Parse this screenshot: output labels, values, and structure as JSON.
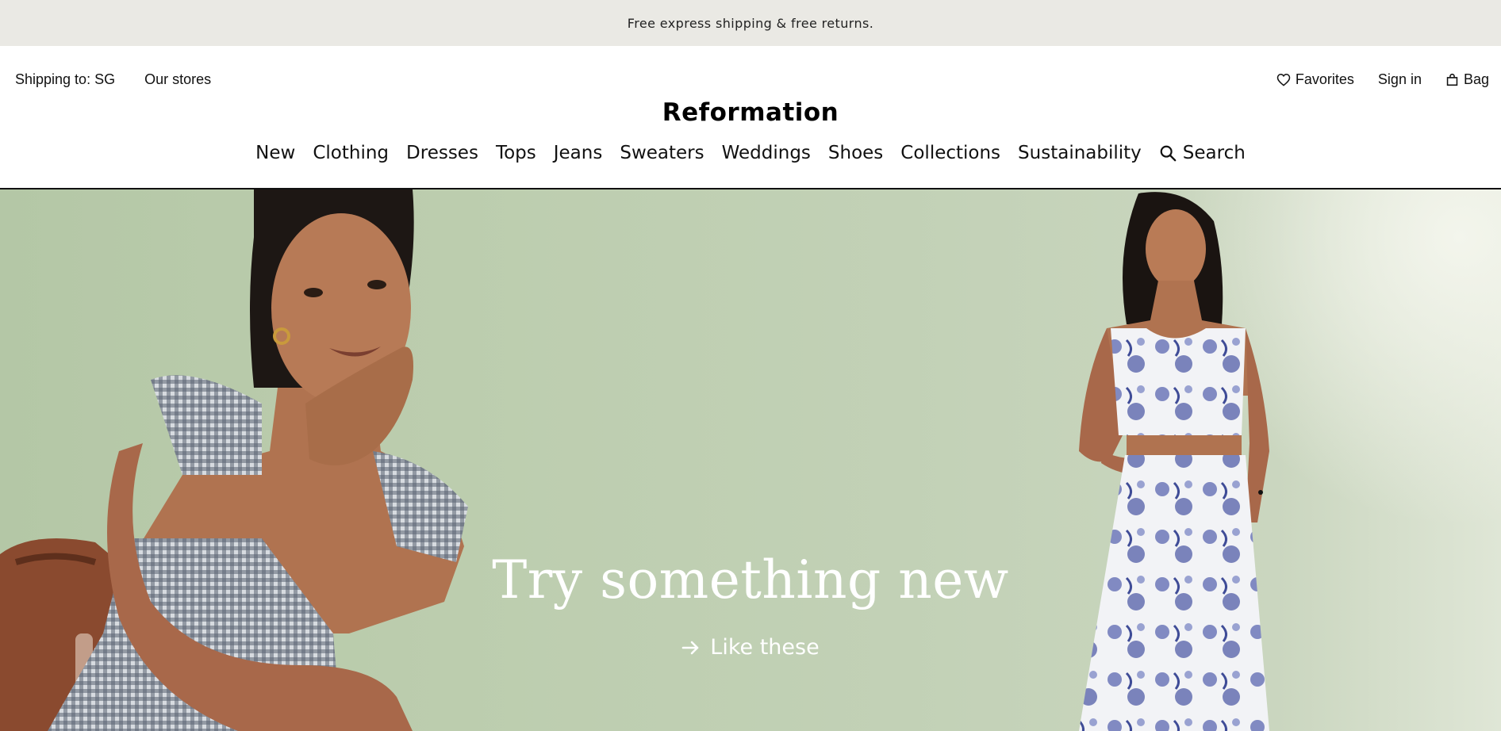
{
  "announcement": "Free express shipping & free returns.",
  "header": {
    "shipping_label": "Shipping to: SG",
    "stores_label": "Our stores",
    "favorites_label": "Favorites",
    "signin_label": "Sign in",
    "bag_label": "Bag",
    "logo": "Reformation"
  },
  "nav": {
    "items": [
      "New",
      "Clothing",
      "Dresses",
      "Tops",
      "Jeans",
      "Sweaters",
      "Weddings",
      "Shoes",
      "Collections",
      "Sustainability"
    ],
    "search_label": "Search"
  },
  "hero": {
    "title": "Try something new",
    "cta_label": "Like these",
    "background_color": "#bccdae"
  },
  "icons": {
    "favorites": "heart-icon",
    "bag": "bag-icon",
    "search": "search-icon",
    "cta": "arrow-right-icon"
  }
}
